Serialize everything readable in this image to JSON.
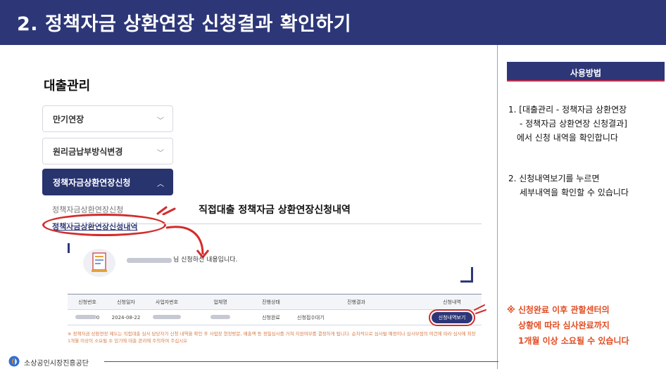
{
  "header": {
    "title": "2. 정책자금 상환연장 신청결과 확인하기"
  },
  "left": {
    "section_title": "대출관리",
    "menu": [
      {
        "label": "만기연장",
        "chevron": "chevron-down",
        "active": false
      },
      {
        "label": "원리금납부방식변경",
        "chevron": "chevron-down",
        "active": false
      },
      {
        "label": "정책자금상환연장신청",
        "chevron": "chevron-up",
        "active": true
      }
    ],
    "sub_items": [
      {
        "label": "정책자금상환연장신청",
        "current": false
      },
      {
        "label": "정책자금상환연장신청내역",
        "current": true
      }
    ],
    "list_title": "직접대출 정책자금 상환연장신청내역",
    "message": "님 신청하신 내용입니다.",
    "table": {
      "headers": [
        "신청번호",
        "신청일자",
        "사업자번호",
        "업체명",
        "진행상태",
        "진행결과",
        "신청내역"
      ],
      "rows": [
        {
          "no_suffix": "0",
          "date": "2024-08-22",
          "status": "신청완료",
          "result": "신청접수대기",
          "action": "신청내역보기"
        }
      ]
    },
    "notice": "※ 정책자금 상환연장 제도는 직접대출 심사 담당자가 신청 내역을 확인 후 사업장 현장방문, 매출액 등 정밀심사를 거쳐 지원여부를 결정하게 됩니다. 순차적으로 심사될 예정이나 심사부점의 여건에 따라 심사에 최장 1개월 이상이 소요될 수 있기에 대출 관리에 주의하여 주십시오"
  },
  "footer": {
    "org": "소상공인시장진흥공단"
  },
  "right": {
    "howto_title": "사용방법",
    "step1_line1": "1. [대출관리 - 정책자금 상환연장",
    "step1_line2": "- 정책자금 상환연장 신청결과]",
    "step1_line3": "에서 신청 내역을 확인합니다",
    "step2_line1": "2. 신청내역보기를 누르면",
    "step2_line2": "세부내역을 확인할 수 있습니다",
    "warn_line1": "※ 신청완료 이후 관할센터의",
    "warn_line2": "상황에 따라 심사완료까지",
    "warn_line3": "1개월 이상 소요될 수 있습니다"
  },
  "colors": {
    "primary": "#2d3778",
    "highlight_red": "#d42b2b",
    "warning": "#e14c22"
  }
}
